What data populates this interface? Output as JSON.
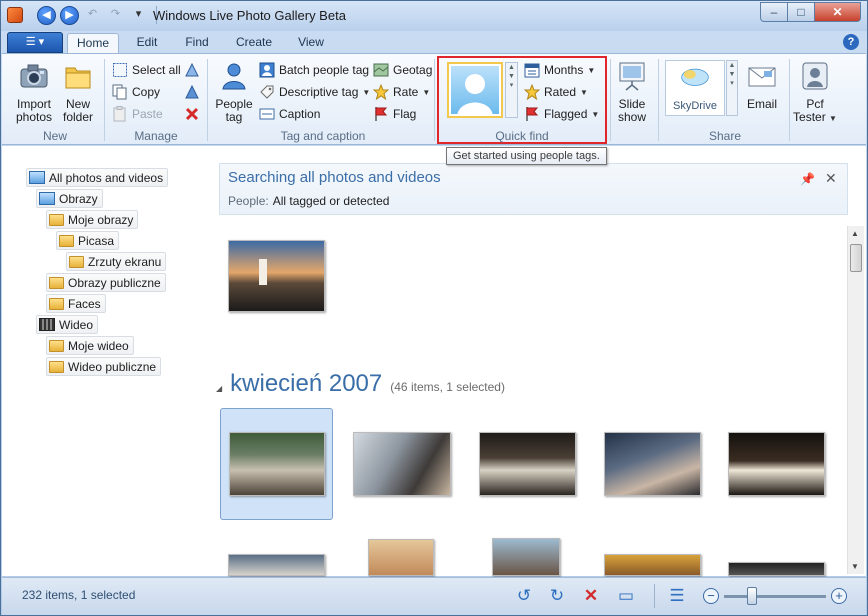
{
  "window": {
    "title": "Windows Live Photo Gallery Beta",
    "controls": {
      "minimize": "–",
      "maximize": "□",
      "close": "✕"
    }
  },
  "quick_access": {
    "back": "◀",
    "forward": "▶",
    "undo": "↶",
    "redo": "↷",
    "dropdown": "▾"
  },
  "tabs": {
    "file_glyph": "☰ ▾",
    "items": [
      "Home",
      "Edit",
      "Find",
      "Create",
      "View"
    ],
    "active": "Home",
    "help": "?"
  },
  "ribbon": {
    "new": {
      "label": "New",
      "import": "Import\nphotos",
      "new_folder": "New\nfolder"
    },
    "manage": {
      "label": "Manage",
      "select_all": "Select all",
      "copy": "Copy",
      "paste": "Paste"
    },
    "tag_caption": {
      "label": "Tag and caption",
      "people_tag": "People\ntag",
      "batch_people_tag": "Batch people tag",
      "descriptive_tag": "Descriptive tag",
      "caption": "Caption",
      "geotag": "Geotag",
      "rate": "Rate",
      "flag": "Flag"
    },
    "quick_find": {
      "label": "Quick find",
      "months": "Months",
      "rated": "Rated",
      "flagged": "Flagged"
    },
    "slide_show": "Slide\nshow",
    "share": {
      "label": "Share",
      "skydrive": "SkyDrive",
      "email": "Email",
      "tester": "Pcf\nTester"
    }
  },
  "tooltip": "Get started using people tags.",
  "tree": [
    {
      "label": "All photos and videos",
      "icon": "library-icon",
      "level": 0
    },
    {
      "label": "Obrazy",
      "icon": "library-icon",
      "level": 1
    },
    {
      "label": "Moje obrazy",
      "icon": "folder-icon",
      "level": 2
    },
    {
      "label": "Picasa",
      "icon": "folder-icon",
      "level": 3
    },
    {
      "label": "Zrzuty ekranu",
      "icon": "folder-icon",
      "level": 4
    },
    {
      "label": "Obrazy publiczne",
      "icon": "folder-icon",
      "level": 2
    },
    {
      "label": "Faces",
      "icon": "folder-icon",
      "level": 2
    },
    {
      "label": "Wideo",
      "icon": "video-icon",
      "level": 1
    },
    {
      "label": "Moje wideo",
      "icon": "folder-icon",
      "level": 2
    },
    {
      "label": "Wideo publiczne",
      "icon": "folder-icon",
      "level": 2
    }
  ],
  "search": {
    "title": "Searching all photos and videos",
    "people_label": "People:",
    "people_value": "All tagged or detected"
  },
  "month_group": {
    "title": "kwiecień 2007",
    "count": "(46 items, 1 selected)"
  },
  "status": {
    "text": "232 items, 1 selected"
  }
}
